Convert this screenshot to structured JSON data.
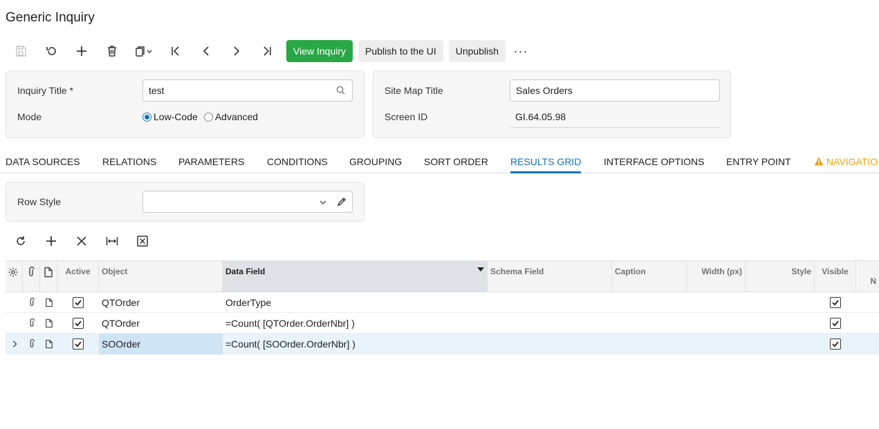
{
  "header": {
    "title": "Generic Inquiry"
  },
  "toolbar": {
    "view_inquiry": "View Inquiry",
    "publish": "Publish to the UI",
    "unpublish": "Unpublish",
    "more": "···"
  },
  "form_left": {
    "inquiry_title_label": "Inquiry Title",
    "required_mark": "*",
    "inquiry_title_value": "test",
    "mode_label": "Mode",
    "mode_options": [
      "Low-Code",
      "Advanced"
    ],
    "mode_selected": "Low-Code"
  },
  "form_right": {
    "site_map_title_label": "Site Map Title",
    "site_map_title_value": "Sales Orders",
    "screen_id_label": "Screen ID",
    "screen_id_value": "GI.64.05.98"
  },
  "tabs": [
    {
      "label": "DATA SOURCES"
    },
    {
      "label": "RELATIONS"
    },
    {
      "label": "PARAMETERS"
    },
    {
      "label": "CONDITIONS"
    },
    {
      "label": "GROUPING"
    },
    {
      "label": "SORT ORDER"
    },
    {
      "label": "RESULTS GRID",
      "active": true
    },
    {
      "label": "INTERFACE OPTIONS"
    },
    {
      "label": "ENTRY POINT"
    },
    {
      "label": "NAVIGATIO",
      "warning": true
    }
  ],
  "row_style": {
    "label": "Row Style",
    "value": ""
  },
  "grid": {
    "columns": {
      "active": "Active",
      "object": "Object",
      "data_field": "Data Field",
      "schema_field": "Schema Field",
      "caption": "Caption",
      "width": "Width (px)",
      "style": "Style",
      "visible": "Visible",
      "next": "N"
    },
    "rows": [
      {
        "active": true,
        "object": "QTOrder",
        "data_field": "OrderType",
        "visible": true
      },
      {
        "active": true,
        "object": "QTOrder",
        "data_field": "=Count( [QTOrder.OrderNbr] )",
        "visible": true
      },
      {
        "active": true,
        "object": "SOOrder",
        "data_field": "=Count( [SOOrder.OrderNbr] )",
        "visible": true,
        "selected": true
      }
    ]
  },
  "colors": {
    "primary_green": "#28a744",
    "accent_blue": "#1470b8",
    "warning": "#e7a415"
  }
}
